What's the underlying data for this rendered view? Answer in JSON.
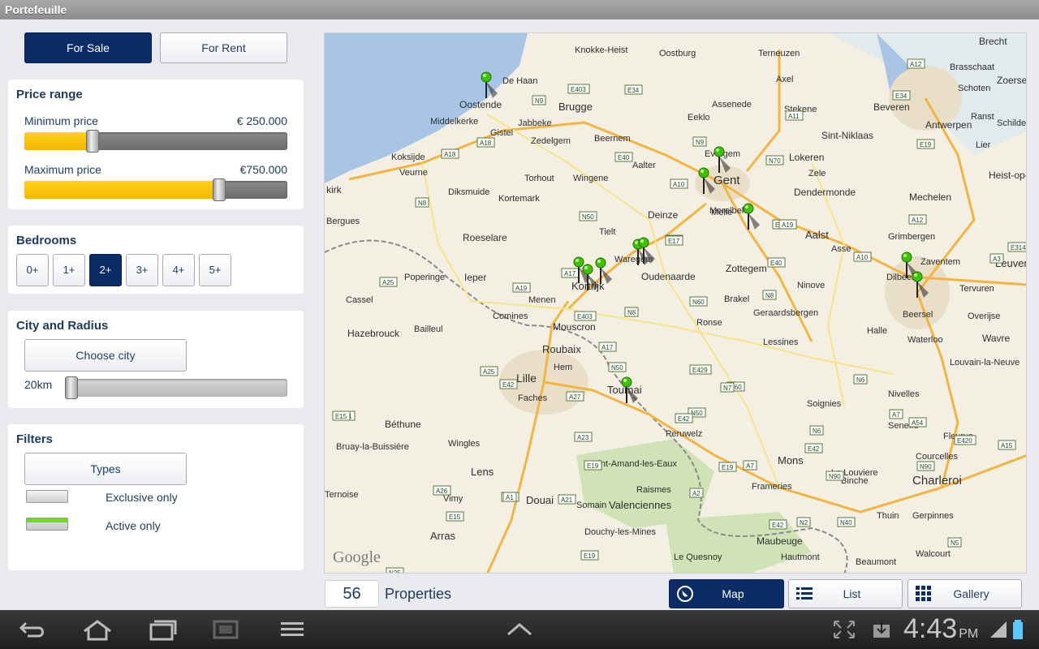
{
  "app": {
    "title": "Portefeuille"
  },
  "listing_type": {
    "for_sale": "For Sale",
    "for_rent": "For Rent"
  },
  "price": {
    "title": "Price range",
    "min_label": "Minimum price",
    "min_value": "€ 250.000",
    "min_fraction": 0.26,
    "max_label": "Maximum price",
    "max_value": "€750.000",
    "max_fraction": 0.74
  },
  "bedrooms": {
    "title": "Bedrooms",
    "options": [
      "0+",
      "1+",
      "2+",
      "3+",
      "4+",
      "5+"
    ],
    "selected": "2+"
  },
  "city": {
    "title": "City and Radius",
    "choose_label": "Choose city",
    "radius_label": "20km",
    "radius_fraction": 0.03
  },
  "filters": {
    "title": "Filters",
    "types_label": "Types",
    "exclusive_label": "Exclusive only",
    "exclusive_on": false,
    "active_label": "Active only",
    "active_on": true
  },
  "results": {
    "count": "56",
    "label": "Properties"
  },
  "views": {
    "map": "Map",
    "list": "List",
    "gallery": "Gallery",
    "selected": "Map"
  },
  "map": {
    "attribution": "Google",
    "towns": [
      "Brecht",
      "Knokke-Heist",
      "Oostburg",
      "Terneuzen",
      "Axel",
      "De Haan",
      "Brugge",
      "Assenede",
      "Oostende",
      "Middelkerke",
      "Jabbeke",
      "Eeklo",
      "Stekene",
      "Beveren",
      "Antwerpen",
      "Gistel",
      "Zedelgem",
      "Beernem",
      "Sint-Niklaas",
      "Koksijde",
      "Evergem",
      "Lokeren",
      "Veurne",
      "Torhout",
      "Wingene",
      "Aalter",
      "Gent",
      "Zele",
      "Diksmuide",
      "Kortemark",
      "Melle",
      "Merelbeke",
      "Dendermonde",
      "Mechelen",
      "kirk",
      "Bergues",
      "Tielt",
      "Deinze",
      "Roeselare",
      "Aalst",
      "Grimbergen",
      "Poperinge",
      "Ieper",
      "Waregem",
      "Kortrijk",
      "Zottegem",
      "Oudenaarde",
      "Asse",
      "Dilbeek",
      "Zaventem",
      "Leuven",
      "Tervuren",
      "Cassel",
      "Menen",
      "Comines",
      "Brakel",
      "Ninove",
      "Beersel",
      "Overijse",
      "Hazebrouck",
      "Bailleul",
      "Mouscron",
      "Ronse",
      "Geraardsbergen",
      "Lessines",
      "Halle",
      "Waterloo",
      "Wavre",
      "Roubaix",
      "Lille",
      "Hem",
      "Faches",
      "Tournai",
      "Louvain-la-Neuve",
      "Nivelles",
      "Soignies",
      "Béthune",
      "Peruwelz",
      "Seneffe",
      "Courcelles",
      "Bruay-la-Buissière",
      "Wingles",
      "Lens",
      "Saint-Amand-les-Eaux",
      "Mons",
      "La Louviere",
      "Binche",
      "Charleroi",
      "Fleurus",
      "Raismes",
      "Frameries",
      "Douai",
      "Somain",
      "Valenciennes",
      "Thuin",
      "Gerpinnes",
      "Ternoise",
      "Vimy",
      "Arras",
      "Douchy-les-Mines",
      "Maubeuge",
      "Hautmont",
      "Le Quesnoy",
      "Beaumont",
      "Walcourt",
      "Zoersel",
      "Schoten",
      "Ranst",
      "Lier",
      "Heist-op-den",
      "Schilde",
      "Brasschaat"
    ],
    "roads": [
      "E403",
      "E34",
      "A12",
      "N9",
      "E34",
      "A11",
      "A18",
      "A18",
      "E40",
      "N9",
      "N70",
      "E19",
      "E40",
      "A10",
      "E17",
      "A12",
      "N50",
      "E17",
      "N8",
      "A17",
      "A19",
      "A10",
      "E40",
      "A3",
      "E314",
      "A25",
      "N8",
      "N8",
      "N60",
      "A19",
      "E403",
      "A17",
      "A25",
      "N50",
      "E429",
      "N60",
      "N7",
      "N6",
      "E42",
      "A27",
      "N41",
      "E15",
      "A23",
      "N50",
      "E42",
      "A7",
      "A54",
      "A15",
      "E19",
      "A7",
      "E42",
      "N6",
      "E420",
      "N90",
      "E19",
      "A21",
      "A26",
      "A2",
      "A1",
      "N90",
      "E15",
      "N40",
      "N5",
      "A21",
      "E19",
      "N25",
      "A2",
      "E42",
      "N2"
    ]
  }
}
